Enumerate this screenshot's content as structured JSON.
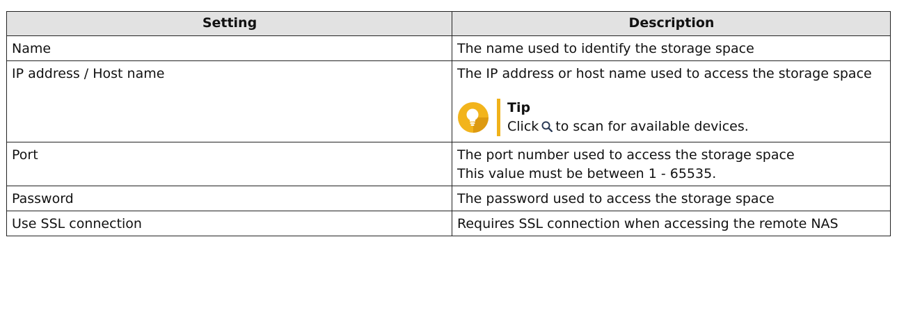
{
  "table": {
    "headers": [
      "Setting",
      "Description"
    ],
    "rows": [
      {
        "setting": "Name",
        "description": "The name used to identify the storage space"
      },
      {
        "setting": "IP address / Host name",
        "description": "The IP address or host name used to access the storage space",
        "tip": {
          "title": "Tip",
          "text_before": "Click",
          "icon": "search-icon",
          "text_after": "to scan for available devices."
        }
      },
      {
        "setting": "Port",
        "description": "The port number used to access the storage space",
        "description_line2": "This value must be between 1 - 65535."
      },
      {
        "setting": "Password",
        "description": "The password used to access the storage space"
      },
      {
        "setting": "Use SSL connection",
        "description": "Requires SSL connection when accessing the remote NAS"
      }
    ]
  },
  "colors": {
    "header_background": "#e2e2e2",
    "tip_accent": "#f0b21a",
    "tip_icon": "#f2b41c"
  }
}
